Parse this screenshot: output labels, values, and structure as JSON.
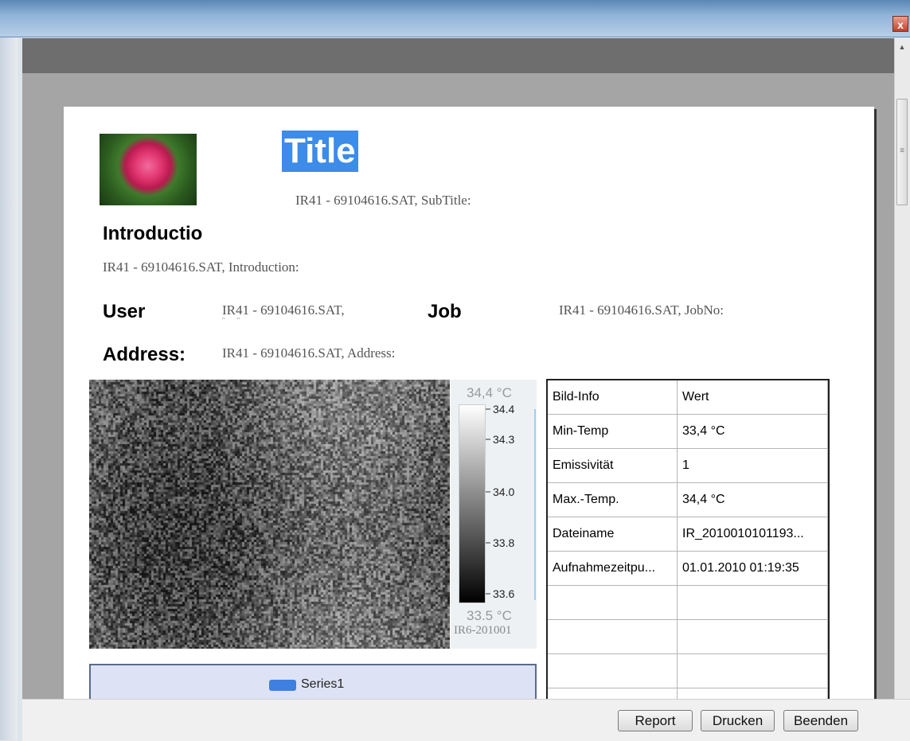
{
  "window": {
    "close_label": "x"
  },
  "report": {
    "title": "Title",
    "subtitle": "IR41 - 69104616.SAT, SubTitle:",
    "introduction_heading": "Introductio",
    "introduction_value": "IR41 - 69104616.SAT, Introduction:",
    "user_label": "User",
    "user_value": "IR41 - 69104616.SAT,",
    "job_label": "Job",
    "job_value": "IR41 - 69104616.SAT, JobNo:",
    "address_label": "Address:",
    "address_value": "IR41 - 69104616.SAT, Address:"
  },
  "thermal": {
    "max_label": "34,4 °C",
    "min_label": "33.5 °C",
    "scale_ticks": [
      "34.4",
      "34.3",
      "34.0",
      "33.8",
      "33.6"
    ],
    "file_label": "IR6-201001"
  },
  "legend": {
    "series_name": "Series1",
    "color": "#3f7fdf"
  },
  "info_table": {
    "header": [
      "Bild-Info",
      "Wert"
    ],
    "rows": [
      [
        "Min-Temp",
        "33,4 °C"
      ],
      [
        "Emissivität",
        "1"
      ],
      [
        "Max.-Temp.",
        "34,4 °C"
      ],
      [
        "Dateiname",
        "IR_2010010101193..."
      ],
      [
        "Aufnahmezeitpu...",
        "01.01.2010 01:19:35"
      ],
      [
        "",
        ""
      ],
      [
        "",
        ""
      ],
      [
        "",
        ""
      ],
      [
        "",
        ""
      ]
    ]
  },
  "buttons": {
    "report": "Report",
    "drucken": "Drucken",
    "beenden": "Beenden"
  }
}
